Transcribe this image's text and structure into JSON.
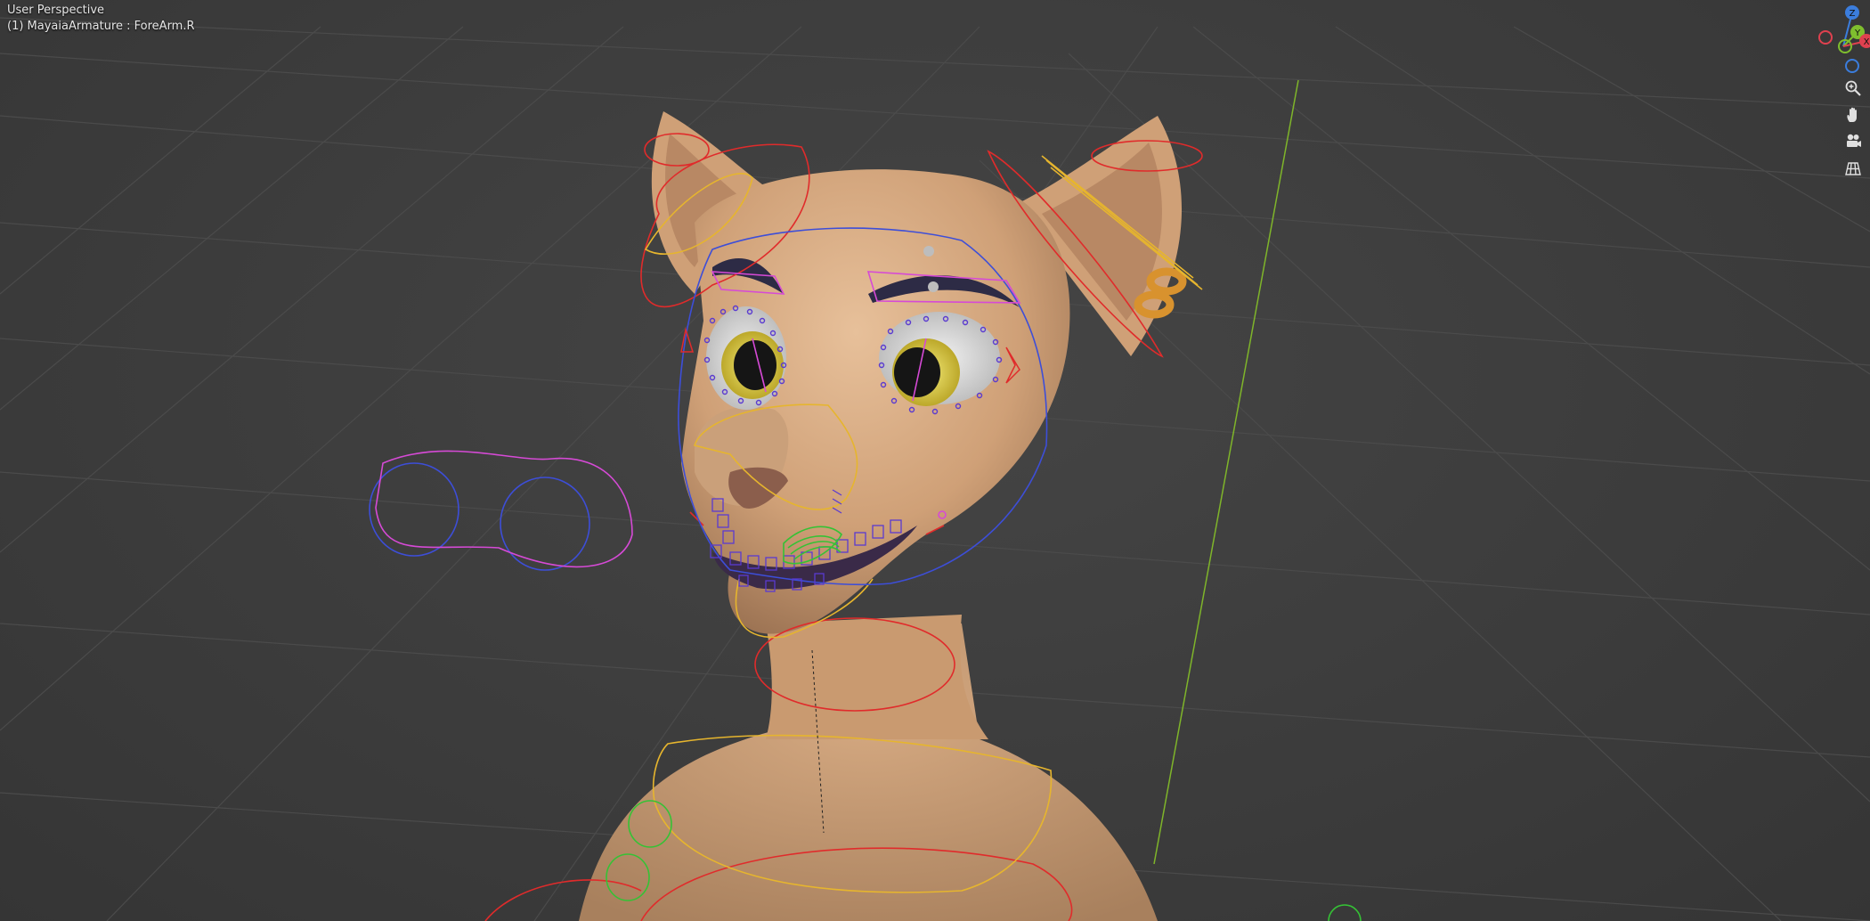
{
  "viewport": {
    "title": "User Perspective",
    "active_object": "(1) MayaiaArmature : ForeArm.R"
  },
  "gizmo": {
    "axes": [
      {
        "label": "Z",
        "color": "#3b7ddd"
      },
      {
        "label": "Y",
        "color": "#7fbf2e"
      },
      {
        "label": "X",
        "color": "#e0414f"
      }
    ]
  },
  "nav_tools": [
    {
      "name": "zoom-icon"
    },
    {
      "name": "hand-pan-icon"
    },
    {
      "name": "camera-view-icon"
    },
    {
      "name": "ortho-grid-icon"
    }
  ],
  "colors": {
    "skin": "#d3a67e",
    "bone_red": "#e02b2b",
    "bone_yellow": "#e6b52e",
    "bone_blue": "#3d4ed8",
    "bone_magenta": "#d64ad6",
    "bone_green": "#35c235",
    "grid": "#4a4a4a"
  }
}
